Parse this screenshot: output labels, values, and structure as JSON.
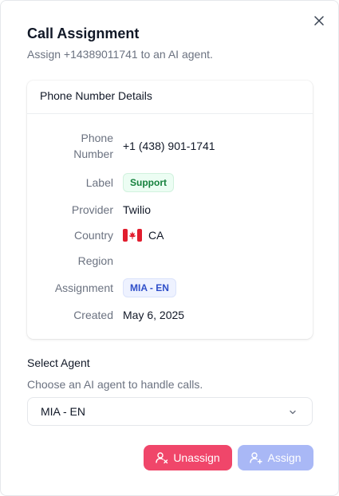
{
  "dialog": {
    "title": "Call Assignment",
    "subtitle": "Assign +14389011741 to an AI agent.",
    "close_icon": "x-icon"
  },
  "details": {
    "header": "Phone Number Details",
    "phone_label_line1": "Phone",
    "phone_label_line2": "Number",
    "phone_value": "+1 (438) 901-1741",
    "label_label": "Label",
    "label_value": "Support",
    "provider_label": "Provider",
    "provider_value": "Twilio",
    "country_label": "Country",
    "country_value": "CA",
    "country_flag_icon": "canada-flag-icon",
    "region_label": "Region",
    "region_value": "",
    "assignment_label": "Assignment",
    "assignment_value": "MIA - EN",
    "created_label": "Created",
    "created_value": "May 6, 2025"
  },
  "agent": {
    "title": "Select Agent",
    "description": "Choose an AI agent to handle calls.",
    "selected": "MIA - EN"
  },
  "actions": {
    "unassign_label": "Unassign",
    "assign_label": "Assign"
  },
  "colors": {
    "unassign_bg": "#f0466a",
    "assign_bg": "#a9b8f6",
    "label_badge_bg": "#ecfdf3",
    "label_badge_text": "#15803d",
    "assignment_badge_bg": "#eef2ff",
    "assignment_badge_text": "#2f4fc9"
  }
}
